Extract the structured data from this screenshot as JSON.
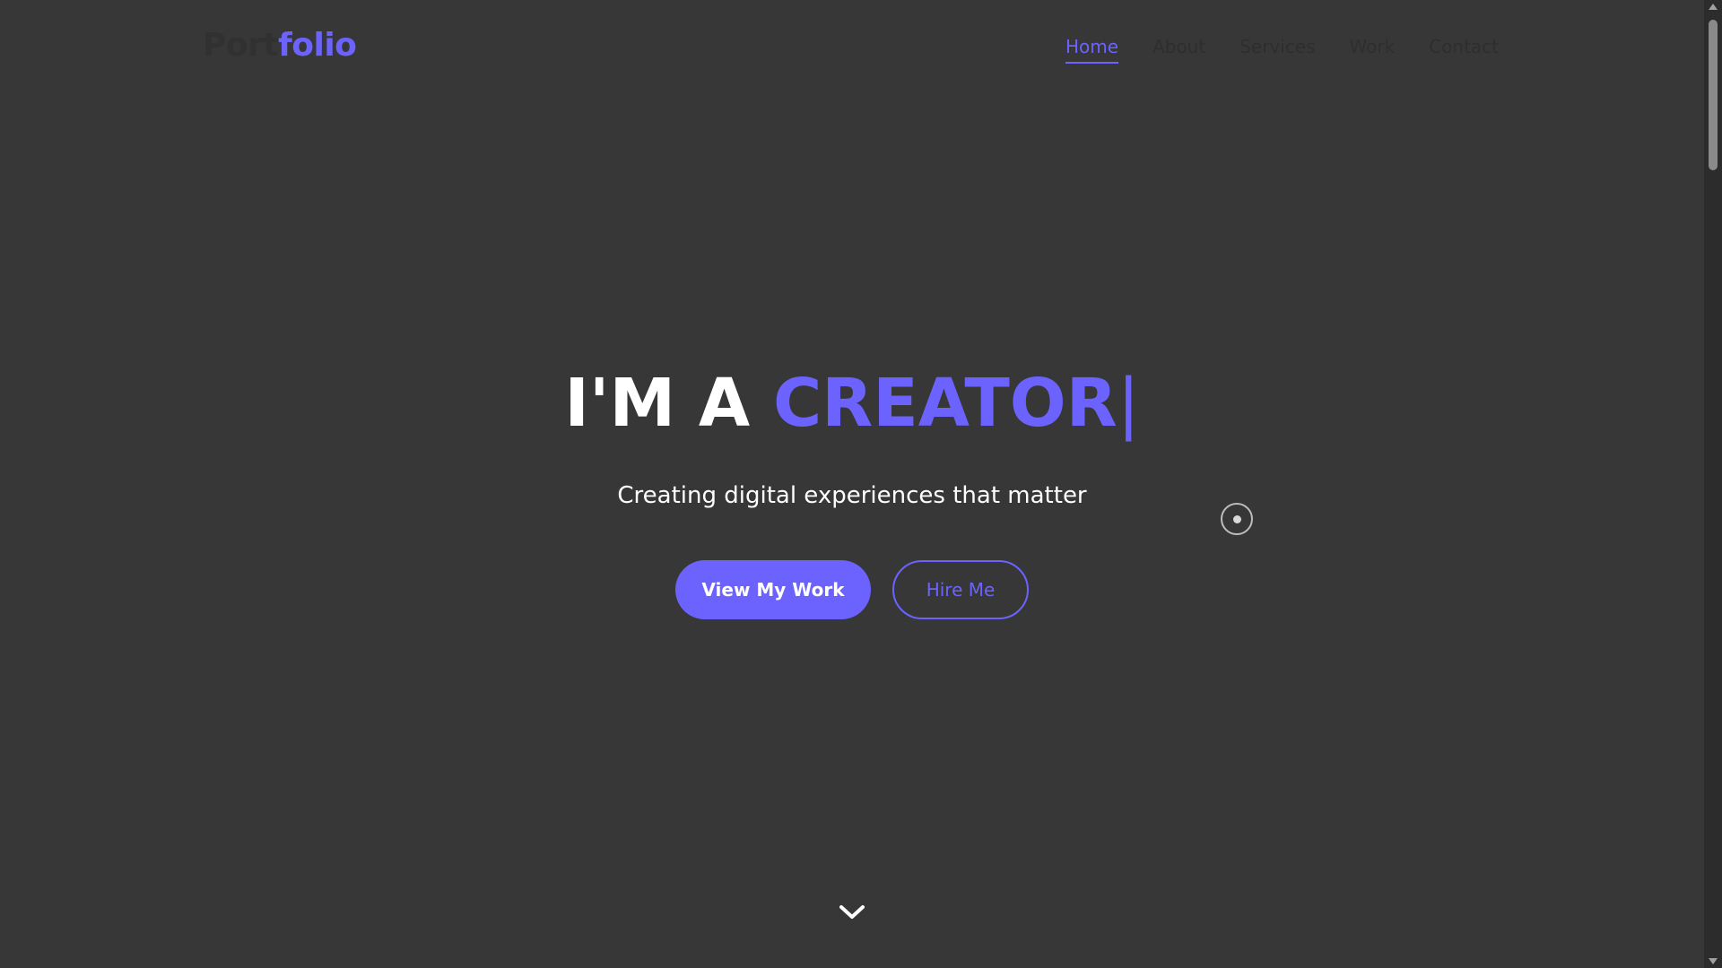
{
  "brand": {
    "logo_part1": "Port",
    "logo_part2": "folio"
  },
  "nav": {
    "items": [
      {
        "label": "Home",
        "active": true
      },
      {
        "label": "About",
        "active": false
      },
      {
        "label": "Services",
        "active": false
      },
      {
        "label": "Work",
        "active": false
      },
      {
        "label": "Contact",
        "active": false
      }
    ]
  },
  "hero": {
    "title_prefix": "I'M A ",
    "title_accent": "CREATOR",
    "title_cursor": "|",
    "subtitle": "Creating digital experiences that matter",
    "primary_button": "View My Work",
    "secondary_button": "Hire Me"
  },
  "icons": {
    "scroll_down": "chevron-down-icon",
    "custom_cursor": "cursor-ring-icon"
  },
  "colors": {
    "background": "#373737",
    "accent": "#6c63ff",
    "text": "#ffffff"
  }
}
